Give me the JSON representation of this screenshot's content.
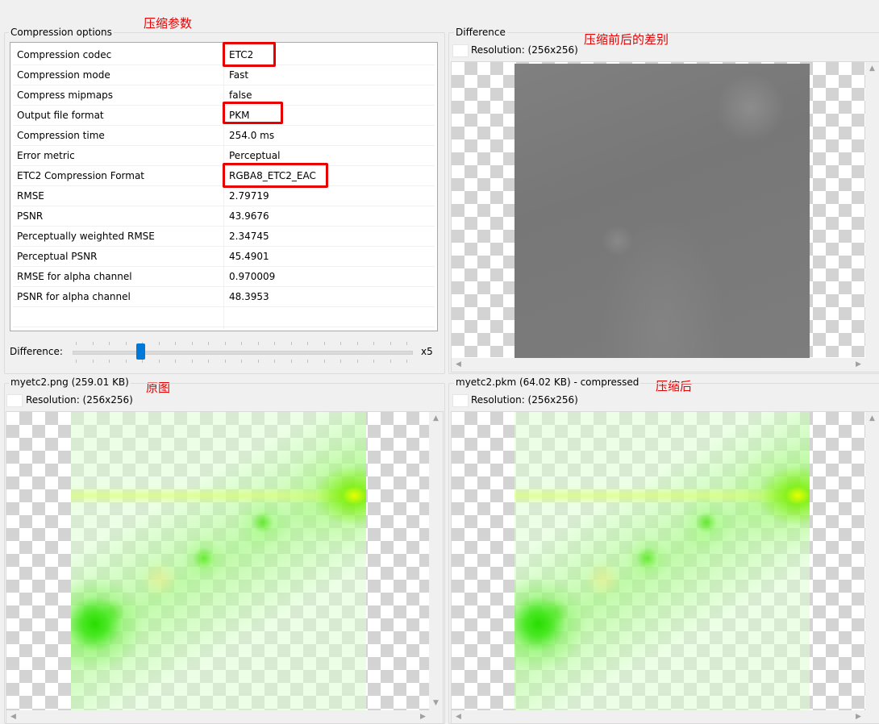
{
  "annotations": {
    "compression_params": "压缩参数",
    "difference_note": "压缩前后的差别",
    "original": "原图",
    "compressed": "压缩后"
  },
  "compression_options": {
    "title": "Compression options",
    "rows": [
      {
        "key": "Compression codec",
        "value": "ETC2"
      },
      {
        "key": "Compression mode",
        "value": "Fast"
      },
      {
        "key": "Compress mipmaps",
        "value": "false"
      },
      {
        "key": "Output file format",
        "value": "PKM"
      },
      {
        "key": "Compression time",
        "value": "254.0 ms"
      },
      {
        "key": "Error metric",
        "value": "Perceptual"
      },
      {
        "key": "ETC2 Compression Format",
        "value": "RGBA8_ETC2_EAC"
      },
      {
        "key": "RMSE",
        "value": "2.79719"
      },
      {
        "key": "PSNR",
        "value": "43.9676"
      },
      {
        "key": "Perceptually weighted RMSE",
        "value": "2.34745"
      },
      {
        "key": "Perceptual PSNR",
        "value": "45.4901"
      },
      {
        "key": "RMSE for alpha channel",
        "value": "0.970009"
      },
      {
        "key": "PSNR for alpha channel",
        "value": "48.3953"
      }
    ],
    "difference_label": "Difference:",
    "difference_value": "x5",
    "slider_level": 0.2
  },
  "difference_panel": {
    "title": "Difference",
    "resolution": "Resolution: (256x256)"
  },
  "original_panel": {
    "title": "myetc2.png (259.01 KB)",
    "resolution": "Resolution: (256x256)"
  },
  "compressed_panel": {
    "title": "myetc2.pkm (64.02 KB) - compressed",
    "resolution": "Resolution: (256x256)"
  },
  "colors": {
    "highlight": "#e60000",
    "slider_thumb": "#0078d7"
  }
}
